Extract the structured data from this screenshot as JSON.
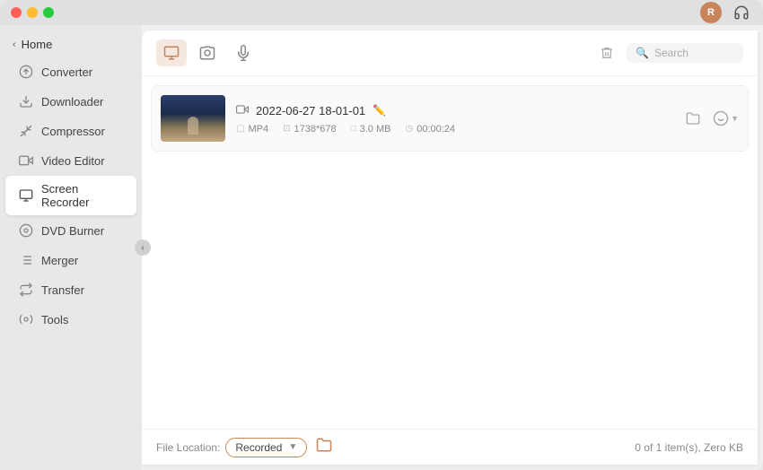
{
  "window": {
    "title": "Screen Recorder"
  },
  "titlebar": {
    "user_avatar_label": "R",
    "headset_icon": "🎧"
  },
  "sidebar": {
    "home_label": "Home",
    "items": [
      {
        "id": "converter",
        "label": "Converter",
        "icon": "converter"
      },
      {
        "id": "downloader",
        "label": "Downloader",
        "icon": "downloader"
      },
      {
        "id": "compressor",
        "label": "Compressor",
        "icon": "compressor"
      },
      {
        "id": "video-editor",
        "label": "Video Editor",
        "icon": "video-editor"
      },
      {
        "id": "screen-recorder",
        "label": "Screen Recorder",
        "icon": "screen-recorder",
        "active": true
      },
      {
        "id": "dvd-burner",
        "label": "DVD Burner",
        "icon": "dvd-burner"
      },
      {
        "id": "merger",
        "label": "Merger",
        "icon": "merger"
      },
      {
        "id": "transfer",
        "label": "Transfer",
        "icon": "transfer"
      },
      {
        "id": "tools",
        "label": "Tools",
        "icon": "tools"
      }
    ]
  },
  "toolbar": {
    "tab_video": "📹",
    "tab_camera": "🎥",
    "tab_mic": "🎙",
    "search_placeholder": "Search"
  },
  "file": {
    "date": "2022-06-27 18-01-01",
    "format": "MP4",
    "resolution": "1738*678",
    "size": "3.0 MB",
    "duration": "00:00:24"
  },
  "footer": {
    "file_location_label": "File Location:",
    "location_option": "Recorded",
    "status": "0 of 1 item(s), Zero KB"
  }
}
